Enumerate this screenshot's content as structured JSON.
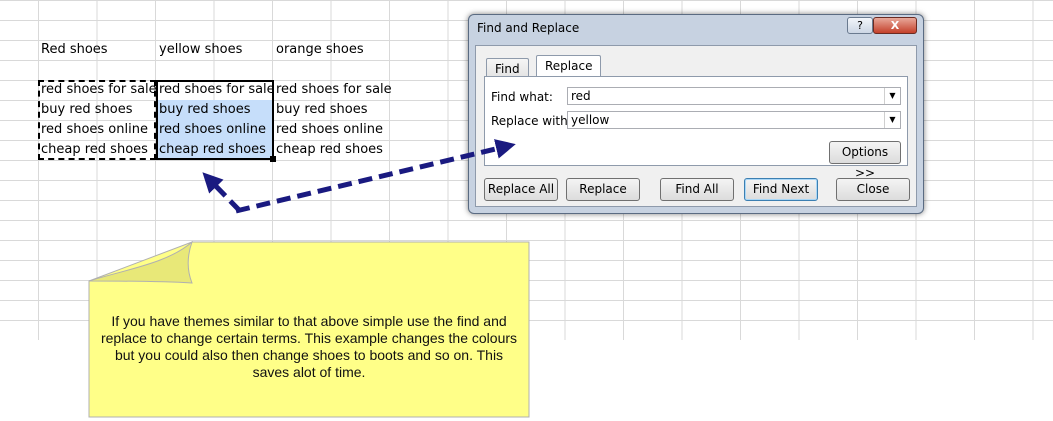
{
  "sheet": {
    "headers": [
      "Red shoes",
      "yellow shoes",
      "orange shoes"
    ],
    "column_a": [
      "red shoes for sale",
      "buy red shoes",
      "red shoes online",
      "cheap red shoes"
    ],
    "column_b": [
      "red shoes for sale",
      "buy red shoes",
      "red shoes online",
      "cheap red shoes"
    ],
    "column_c": [
      "red shoes for sale",
      "buy red shoes",
      "red shoes online",
      "cheap red shoes"
    ]
  },
  "dialog": {
    "title": "Find and Replace",
    "help_label": "?",
    "close_label": "X",
    "tabs": [
      "Find",
      "Replace"
    ],
    "find_label": "Find what:",
    "find_value": "red",
    "replace_label": "Replace with:",
    "replace_value": "yellow",
    "options_label": "Options >>",
    "buttons": {
      "replace_all": "Replace All",
      "replace": "Replace",
      "find_all": "Find All",
      "find_next": "Find Next",
      "close": "Close"
    }
  },
  "note": {
    "text": "If you have themes similar to that above simple use the find and replace to change certain terms. This example changes the colours but you could also then change shoes to boots and so on. This saves alot of time."
  },
  "colors": {
    "selection": "#c6defa",
    "arrow": "#1a1a80",
    "note_fill": "#ffff88"
  }
}
